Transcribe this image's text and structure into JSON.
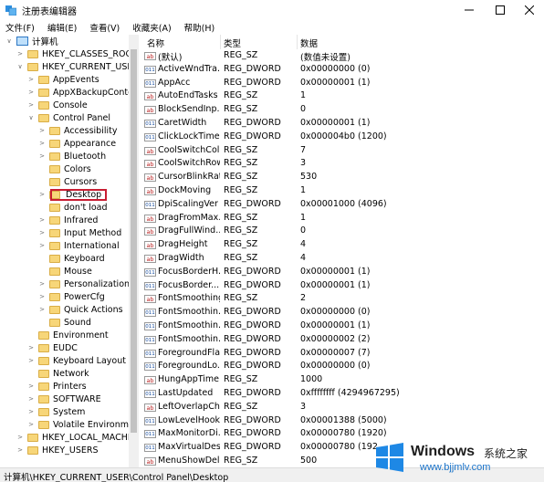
{
  "window": {
    "title": "注册表编辑器"
  },
  "menu": [
    "文件(F)",
    "编辑(E)",
    "查看(V)",
    "收藏夹(A)",
    "帮助(H)"
  ],
  "tree": [
    {
      "label": "计算机",
      "level": 0,
      "exp": "open",
      "icon": "pc"
    },
    {
      "label": "HKEY_CLASSES_ROOT",
      "level": 1,
      "exp": "closed"
    },
    {
      "label": "HKEY_CURRENT_USER",
      "level": 1,
      "exp": "open"
    },
    {
      "label": "AppEvents",
      "level": 2,
      "exp": "closed"
    },
    {
      "label": "AppXBackupContent",
      "level": 2,
      "exp": "closed"
    },
    {
      "label": "Console",
      "level": 2,
      "exp": "closed"
    },
    {
      "label": "Control Panel",
      "level": 2,
      "exp": "open"
    },
    {
      "label": "Accessibility",
      "level": 3,
      "exp": "closed"
    },
    {
      "label": "Appearance",
      "level": 3,
      "exp": "closed"
    },
    {
      "label": "Bluetooth",
      "level": 3,
      "exp": "closed"
    },
    {
      "label": "Colors",
      "level": 3,
      "exp": "none"
    },
    {
      "label": "Cursors",
      "level": 3,
      "exp": "none"
    },
    {
      "label": "Desktop",
      "level": 3,
      "exp": "closed",
      "selected": true
    },
    {
      "label": "don't load",
      "level": 3,
      "exp": "none"
    },
    {
      "label": "Infrared",
      "level": 3,
      "exp": "closed"
    },
    {
      "label": "Input Method",
      "level": 3,
      "exp": "closed"
    },
    {
      "label": "International",
      "level": 3,
      "exp": "closed"
    },
    {
      "label": "Keyboard",
      "level": 3,
      "exp": "none"
    },
    {
      "label": "Mouse",
      "level": 3,
      "exp": "none"
    },
    {
      "label": "Personalization",
      "level": 3,
      "exp": "closed"
    },
    {
      "label": "PowerCfg",
      "level": 3,
      "exp": "closed"
    },
    {
      "label": "Quick Actions",
      "level": 3,
      "exp": "closed"
    },
    {
      "label": "Sound",
      "level": 3,
      "exp": "none"
    },
    {
      "label": "Environment",
      "level": 2,
      "exp": "none"
    },
    {
      "label": "EUDC",
      "level": 2,
      "exp": "closed"
    },
    {
      "label": "Keyboard Layout",
      "level": 2,
      "exp": "closed"
    },
    {
      "label": "Network",
      "level": 2,
      "exp": "none"
    },
    {
      "label": "Printers",
      "level": 2,
      "exp": "closed"
    },
    {
      "label": "SOFTWARE",
      "level": 2,
      "exp": "closed"
    },
    {
      "label": "System",
      "level": 2,
      "exp": "closed"
    },
    {
      "label": "Volatile Environment",
      "level": 2,
      "exp": "closed"
    },
    {
      "label": "HKEY_LOCAL_MACHINE",
      "level": 1,
      "exp": "closed"
    },
    {
      "label": "HKEY_USERS",
      "level": 1,
      "exp": "closed"
    }
  ],
  "columns": {
    "name": "名称",
    "type": "类型",
    "data": "数据"
  },
  "values": [
    {
      "name": "(默认)",
      "type": "REG_SZ",
      "data": "(数值未设置)",
      "kind": "sz"
    },
    {
      "name": "ActiveWndTra...",
      "type": "REG_DWORD",
      "data": "0x00000000 (0)",
      "kind": "dw"
    },
    {
      "name": "AppAcc",
      "type": "REG_DWORD",
      "data": "0x00000001 (1)",
      "kind": "dw"
    },
    {
      "name": "AutoEndTasks",
      "type": "REG_SZ",
      "data": "1",
      "kind": "sz"
    },
    {
      "name": "BlockSendInp...",
      "type": "REG_SZ",
      "data": "0",
      "kind": "sz"
    },
    {
      "name": "CaretWidth",
      "type": "REG_DWORD",
      "data": "0x00000001 (1)",
      "kind": "dw"
    },
    {
      "name": "ClickLockTime",
      "type": "REG_DWORD",
      "data": "0x000004b0 (1200)",
      "kind": "dw"
    },
    {
      "name": "CoolSwitchCol...",
      "type": "REG_SZ",
      "data": "7",
      "kind": "sz"
    },
    {
      "name": "CoolSwitchRows",
      "type": "REG_SZ",
      "data": "3",
      "kind": "sz"
    },
    {
      "name": "CursorBlinkRate",
      "type": "REG_SZ",
      "data": "530",
      "kind": "sz"
    },
    {
      "name": "DockMoving",
      "type": "REG_SZ",
      "data": "1",
      "kind": "sz"
    },
    {
      "name": "DpiScalingVer",
      "type": "REG_DWORD",
      "data": "0x00001000 (4096)",
      "kind": "dw"
    },
    {
      "name": "DragFromMax...",
      "type": "REG_SZ",
      "data": "1",
      "kind": "sz"
    },
    {
      "name": "DragFullWind...",
      "type": "REG_SZ",
      "data": "0",
      "kind": "sz"
    },
    {
      "name": "DragHeight",
      "type": "REG_SZ",
      "data": "4",
      "kind": "sz"
    },
    {
      "name": "DragWidth",
      "type": "REG_SZ",
      "data": "4",
      "kind": "sz"
    },
    {
      "name": "FocusBorderH...",
      "type": "REG_DWORD",
      "data": "0x00000001 (1)",
      "kind": "dw"
    },
    {
      "name": "FocusBorder...",
      "type": "REG_DWORD",
      "data": "0x00000001 (1)",
      "kind": "dw"
    },
    {
      "name": "FontSmoothing",
      "type": "REG_SZ",
      "data": "2",
      "kind": "sz"
    },
    {
      "name": "FontSmoothin...",
      "type": "REG_DWORD",
      "data": "0x00000000 (0)",
      "kind": "dw"
    },
    {
      "name": "FontSmoothin...",
      "type": "REG_DWORD",
      "data": "0x00000001 (1)",
      "kind": "dw"
    },
    {
      "name": "FontSmoothin...",
      "type": "REG_DWORD",
      "data": "0x00000002 (2)",
      "kind": "dw"
    },
    {
      "name": "ForegroundFla...",
      "type": "REG_DWORD",
      "data": "0x00000007 (7)",
      "kind": "dw"
    },
    {
      "name": "ForegroundLo...",
      "type": "REG_DWORD",
      "data": "0x00000000 (0)",
      "kind": "dw"
    },
    {
      "name": "HungAppTime...",
      "type": "REG_SZ",
      "data": "1000",
      "kind": "sz"
    },
    {
      "name": "LastUpdated",
      "type": "REG_DWORD",
      "data": "0xffffffff (4294967295)",
      "kind": "dw"
    },
    {
      "name": "LeftOverlapCh...",
      "type": "REG_SZ",
      "data": "3",
      "kind": "sz"
    },
    {
      "name": "LowLevelHook...",
      "type": "REG_DWORD",
      "data": "0x00001388 (5000)",
      "kind": "dw"
    },
    {
      "name": "MaxMonitorDi...",
      "type": "REG_DWORD",
      "data": "0x00000780 (1920)",
      "kind": "dw"
    },
    {
      "name": "MaxVirtualDes...",
      "type": "REG_DWORD",
      "data": "0x00000780 (192",
      "kind": "dw"
    },
    {
      "name": "MenuShowDel...",
      "type": "REG_SZ",
      "data": "500",
      "kind": "sz"
    }
  ],
  "status": "计算机\\HKEY_CURRENT_USER\\Control Panel\\Desktop",
  "watermark": {
    "brand": "Windows",
    "cn": "系统之家",
    "url": "www.bjjmlv.com"
  },
  "colors": {
    "accent": "#0078d7",
    "highlight": "#c81e32",
    "folder": "#f7d679"
  }
}
